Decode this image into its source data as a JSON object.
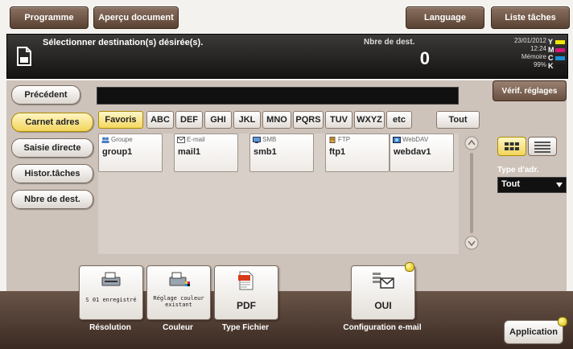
{
  "top_menu": {
    "programme": "Programme",
    "apercu": "Aperçu document",
    "language": "Language",
    "liste_taches": "Liste tâches"
  },
  "status": {
    "message": "Sélectionner destination(s) désirée(s).",
    "dest_label": "Nbre de dest.",
    "dest_count": "0",
    "date": "23/01/2012",
    "time": "12:24",
    "memory_label": "Mémoire",
    "memory_value": "99%",
    "toner": [
      {
        "label": "Y",
        "color": "#f2e600"
      },
      {
        "label": "M",
        "color": "#d4187c"
      },
      {
        "label": "C",
        "color": "#1a8fd8"
      },
      {
        "label": "K",
        "color": "#1a1a1a"
      }
    ]
  },
  "sidebar": {
    "precedent": "Précédent",
    "items": [
      {
        "label": "Carnet adres",
        "selected": true
      },
      {
        "label": "Saisie directe",
        "selected": false
      },
      {
        "label": "Histor.tâches",
        "selected": false
      },
      {
        "label": "Nbre de dest.",
        "selected": false
      }
    ]
  },
  "verif": "Vérif. réglages",
  "index_tabs": [
    "Favoris",
    "ABC",
    "DEF",
    "GHI",
    "JKL",
    "MNO",
    "PQRS",
    "TUV",
    "WXYZ",
    "etc",
    "Tout"
  ],
  "entries": [
    {
      "type": "Groupe",
      "name": "group1",
      "icon": "group-icon"
    },
    {
      "type": "E-mail",
      "name": "mail1",
      "icon": "email-icon"
    },
    {
      "type": "SMB",
      "name": "smb1",
      "icon": "smb-icon"
    },
    {
      "type": "FTP",
      "name": "ftp1",
      "icon": "ftp-icon"
    },
    {
      "type": "WebDAV",
      "name": "webdav1",
      "icon": "webdav-icon"
    }
  ],
  "type_adr": {
    "label": "Type d'adr.",
    "value": "Tout"
  },
  "functions": [
    {
      "id": "resolution",
      "inner": "S 01 enregistré",
      "caption": "Résolution"
    },
    {
      "id": "couleur",
      "inner": "Réglage couleur existant",
      "caption": "Couleur"
    },
    {
      "id": "type-fichier",
      "inner": "PDF",
      "caption": "Type Fichier"
    },
    {
      "id": "config-email",
      "inner": "OUI",
      "caption": "Configuration e-mail"
    }
  ],
  "application": "Application"
}
